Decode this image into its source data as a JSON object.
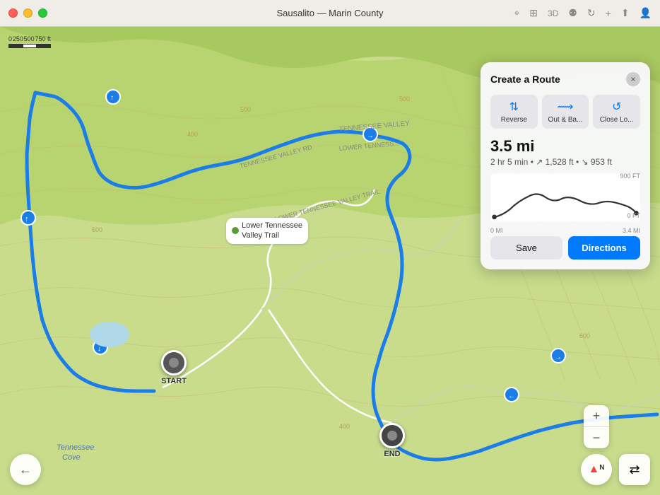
{
  "titlebar": {
    "title": "Sausalito — Marin County"
  },
  "scale": {
    "values": [
      "0",
      "250",
      "500",
      "750 ft"
    ]
  },
  "panel": {
    "title": "Create a Route",
    "close_label": "×",
    "buttons": [
      {
        "id": "reverse",
        "icon": "⇅",
        "label": "Reverse"
      },
      {
        "id": "out-back",
        "icon": "⟿",
        "label": "Out & Ba..."
      },
      {
        "id": "close-loop",
        "icon": "↺",
        "label": "Close Lo..."
      }
    ],
    "stats": {
      "distance": "3.5 mi",
      "detail": "2 hr 5 min • ↗ 1,528 ft • ↘ 953 ft"
    },
    "elevation": {
      "y_max_label": "900 FT",
      "y_min_label": "0 FT",
      "x_start_label": "0 MI",
      "x_end_label": "3.4 MI"
    },
    "save_label": "Save",
    "directions_label": "Directions"
  },
  "markers": {
    "start": "START",
    "end": "END"
  },
  "trail_label": "Lower Tennessee\nValley Trail",
  "map_labels": {
    "tennessee_valley_rd": "TENNESSEE VALLEY RD",
    "lower_tennessee": "LOWER TENNESSEE VALLEY TRAIL",
    "tennessee_valley": "TENNESSEE VALLEY",
    "lower_tennessee2": "LOWER TENNESS..."
  },
  "controls": {
    "zoom_in": "+",
    "zoom_out": "−",
    "north": "N",
    "back": "←",
    "filter": "⇄"
  }
}
